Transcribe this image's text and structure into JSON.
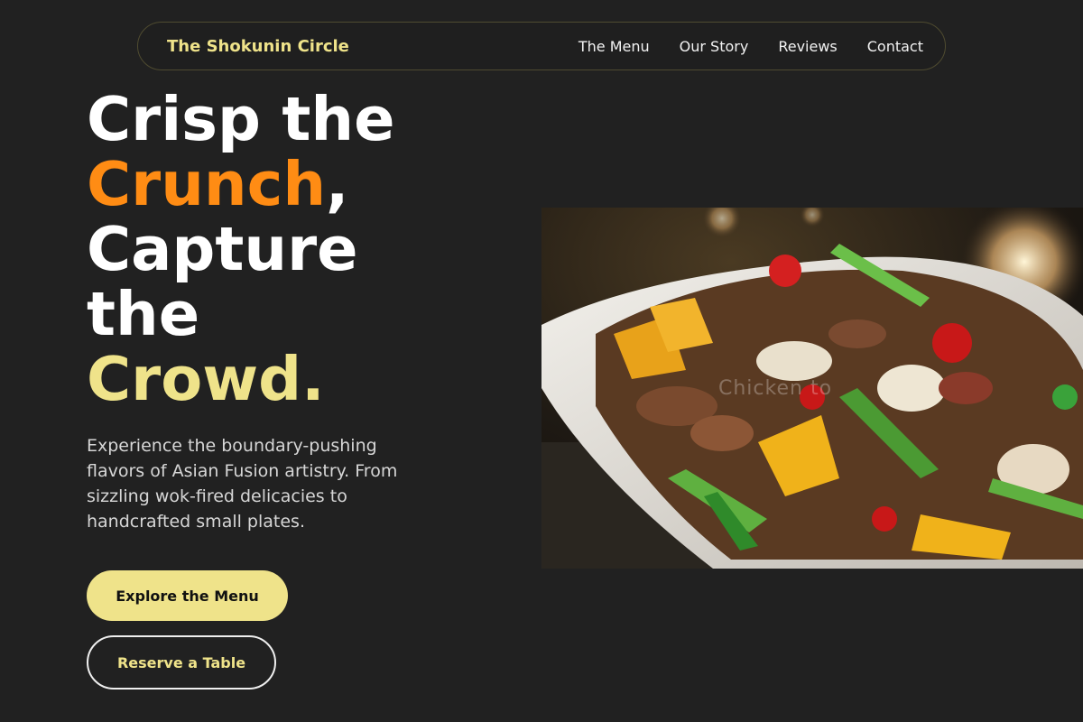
{
  "nav": {
    "brand": "The Shokunin Circle",
    "links": [
      "The Menu",
      "Our Story",
      "Reviews",
      "Contact"
    ]
  },
  "hero": {
    "line1": "Crisp the",
    "line2_accent": "Crunch",
    "line2_comma": ",",
    "line3": "Capture",
    "line4": "the",
    "line5_accent": "Crowd.",
    "description": "Experience the boundary-pushing flavors of Asian Fusion artistry. From sizzling wok-fired delicacies to handcrafted small plates.",
    "primary_cta": "Explore the Menu",
    "secondary_cta": "Reserve a Table",
    "image_watermark": "Chicken to"
  },
  "colors": {
    "background": "#212121",
    "accent_yellow": "#efe38a",
    "accent_orange": "#ff8c14"
  },
  "icons": {
    "hero_image": "stir-fry-dish-photo"
  }
}
